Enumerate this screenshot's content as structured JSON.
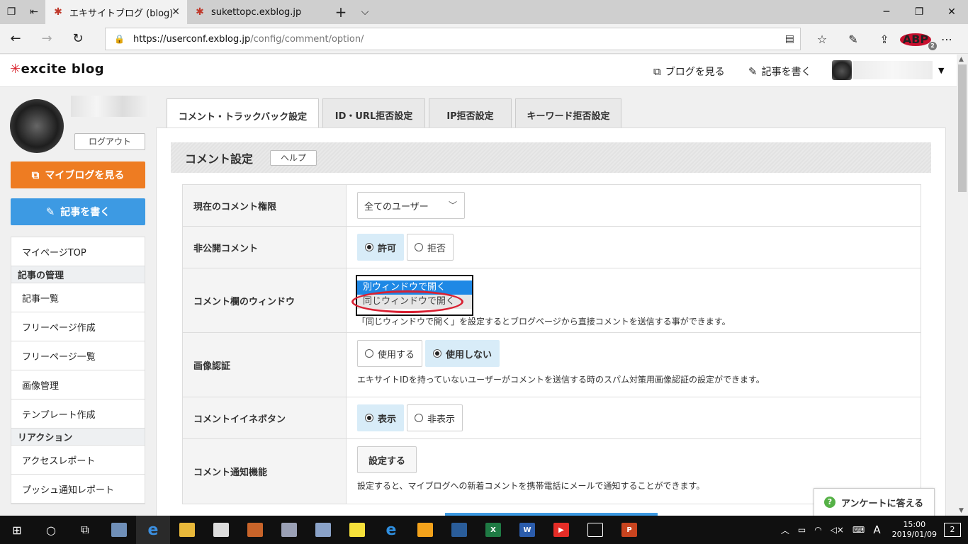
{
  "browser": {
    "tabs": [
      {
        "title": "エキサイトブログ (blog)|コメ",
        "active": true
      },
      {
        "title": "sukettopc.exblog.jp",
        "active": false
      }
    ],
    "url_host": "https://userconf.exblog.jp",
    "url_path": "/config/comment/option/"
  },
  "site": {
    "logo_text": "excite blog",
    "header_links": {
      "view_blog": "ブログを見る",
      "write_post": "記事を書く"
    }
  },
  "sidebar": {
    "logout": "ログアウト",
    "my_blog": "マイブログを見る",
    "write": "記事を書く",
    "nav": [
      {
        "type": "item",
        "label": "マイページTOP"
      },
      {
        "type": "section",
        "label": "記事の管理"
      },
      {
        "type": "item",
        "label": "記事一覧"
      },
      {
        "type": "item",
        "label": "フリーページ作成"
      },
      {
        "type": "item",
        "label": "フリーページ一覧"
      },
      {
        "type": "item",
        "label": "画像管理"
      },
      {
        "type": "item",
        "label": "テンプレート作成"
      },
      {
        "type": "section",
        "label": "リアクション"
      },
      {
        "type": "item",
        "label": "アクセスレポート"
      },
      {
        "type": "item",
        "label": "プッシュ通知レポート"
      }
    ]
  },
  "main": {
    "tabs": [
      {
        "label": "コメント・トラックバック設定",
        "active": true
      },
      {
        "label": "ID・URL拒否設定",
        "active": false
      },
      {
        "label": "IP拒否設定",
        "active": false
      },
      {
        "label": "キーワード拒否設定",
        "active": false
      }
    ],
    "section_title": "コメント設定",
    "help": "ヘルプ",
    "rows": {
      "permission": {
        "label": "現在のコメント権限",
        "value": "全てのユーザー"
      },
      "private": {
        "label": "非公開コメント",
        "options": [
          "許可",
          "拒否"
        ],
        "selected": 0
      },
      "window": {
        "label": "コメント欄のウィンドウ",
        "options": [
          "別ウィンドウで開く",
          "同じウィンドウで開く"
        ],
        "note": "「同じウィンドウで開く」を設定するとブログページから直接コメントを送信する事ができます。"
      },
      "captcha": {
        "label": "画像認証",
        "options": [
          "使用する",
          "使用しない"
        ],
        "selected": 1,
        "note": "エキサイトIDを持っていないユーザーがコメントを送信する時のスパム対策用画像認証の設定ができます。"
      },
      "like": {
        "label": "コメントイイネボタン",
        "options": [
          "表示",
          "非表示"
        ],
        "selected": 0
      },
      "notify": {
        "label": "コメント通知機能",
        "button": "設定する",
        "note": "設定すると、マイブログへの新着コメントを携帯電話にメールで通知することができます。"
      }
    },
    "survey": "アンケートに答える"
  },
  "taskbar": {
    "time": "15:00",
    "date": "2019/01/09",
    "ime": "A",
    "notifications": "2"
  }
}
